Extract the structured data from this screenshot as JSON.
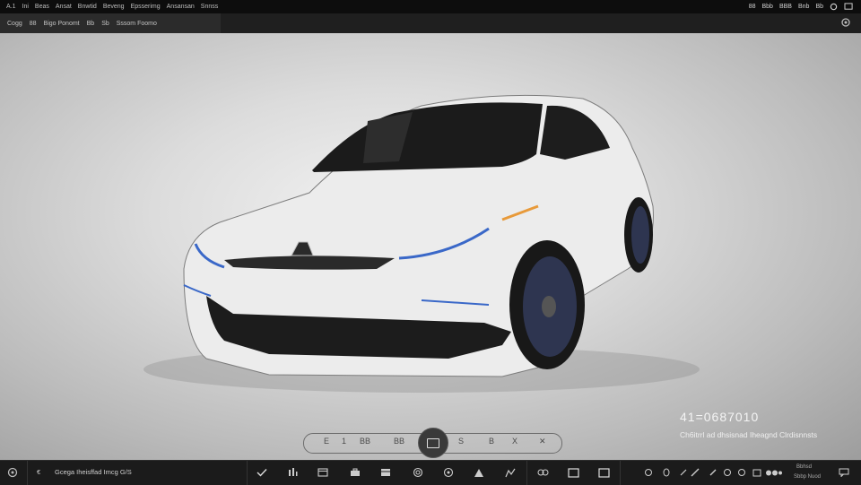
{
  "menu": {
    "items": [
      "A.1",
      "Ini",
      "Beas",
      "Ansat",
      "Bnwtid",
      "Beveng",
      "Epsserimg",
      "Ansansan",
      "Snnss"
    ],
    "right_items": [
      "88",
      "Bbb",
      "BBB",
      "Bnb",
      "Bb"
    ]
  },
  "tabs": [
    "Cogg",
    "88",
    "Bigo Ponomt",
    "Bb",
    "Sb",
    "Sssom Foomo"
  ],
  "readout": {
    "value": "41=0687010",
    "caption": "Ch6itrrl ad dhsisnad Iheagnd Clrdisnnsts"
  },
  "playback": {
    "segments": [
      "E",
      "1",
      "BB",
      "BB",
      "S",
      "B",
      "X"
    ]
  },
  "toolbar": {
    "left_label": "Gcega Iheisffad Imcg G/S",
    "right_labels": [
      "Bbhsd",
      "Sbbp Nuod"
    ]
  },
  "icons": [
    "app-icon",
    "settings-icon",
    "check-icon",
    "frame-icon",
    "briefcase-icon",
    "film-icon",
    "target-icon",
    "circle-icon",
    "triangle-icon",
    "chart-icon",
    "square-icon",
    "comment-icon",
    "pencil-icon"
  ]
}
